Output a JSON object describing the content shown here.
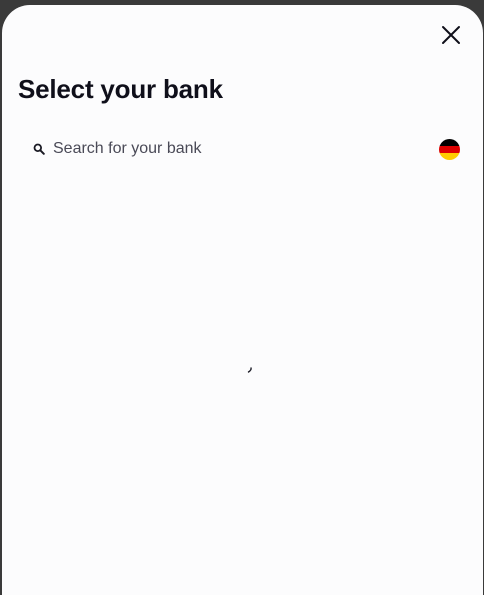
{
  "modal": {
    "title": "Select your bank",
    "close_icon": "close-icon"
  },
  "search": {
    "placeholder": "Search for your bank",
    "value": "",
    "icon": "search-icon"
  },
  "country_selector": {
    "flag_icon": "germany-flag-icon",
    "flag_colors": [
      "#000000",
      "#dd0000",
      "#ffcc00"
    ]
  },
  "loading": {
    "icon": "loading-spinner-icon"
  }
}
